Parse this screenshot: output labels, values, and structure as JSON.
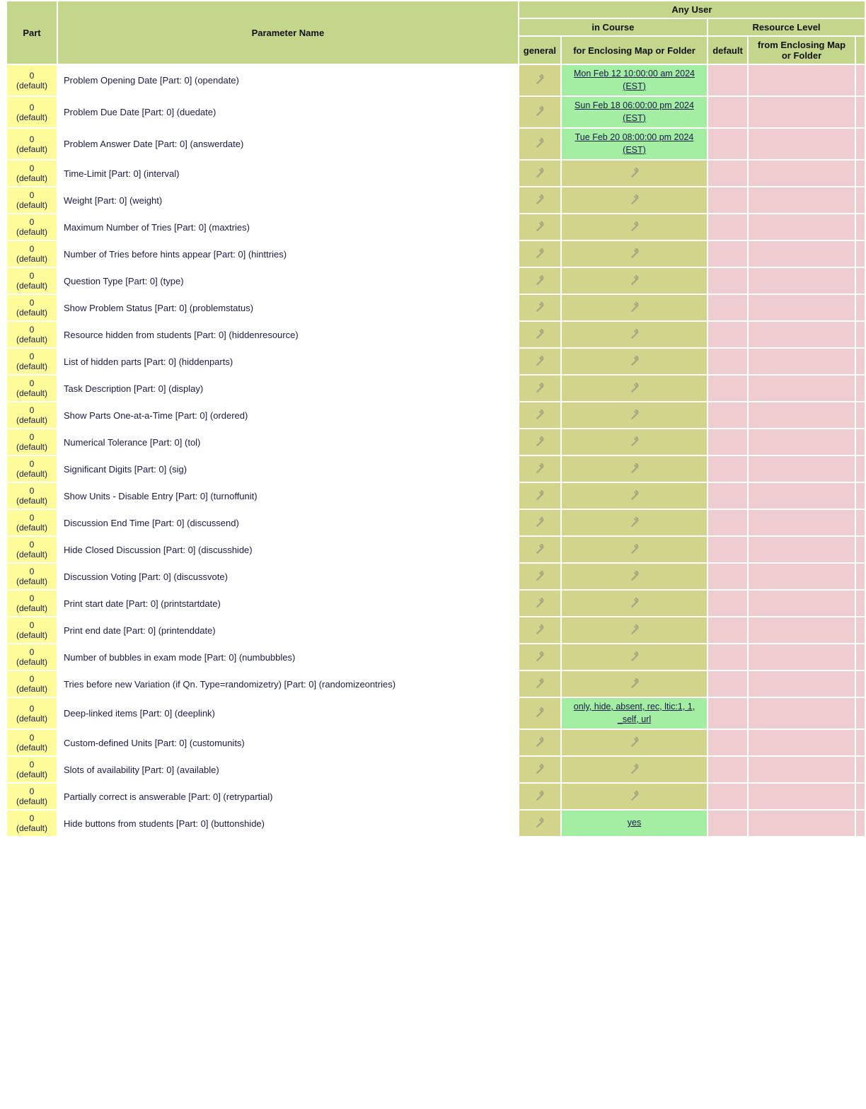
{
  "headers": {
    "any_user": "Any User",
    "in_course": "in Course",
    "resource_level": "Resource Level",
    "part": "Part",
    "parameter_name": "Parameter Name",
    "general": "general",
    "for_enclosing": "for Enclosing Map or Folder",
    "default": "default",
    "from_enclosing": "from Enclosing Map or Folder"
  },
  "rows": [
    {
      "part": "0 (default)",
      "name": "Problem Opening Date [Part: 0] (opendate)",
      "enclosing_val": "Mon Feb 12 10:00:00 am 2024 (EST)",
      "green": true
    },
    {
      "part": "0 (default)",
      "name": "Problem Due Date [Part: 0] (duedate)",
      "enclosing_val": "Sun Feb 18 06:00:00 pm 2024 (EST)",
      "green": true
    },
    {
      "part": "0 (default)",
      "name": "Problem Answer Date [Part: 0] (answerdate)",
      "enclosing_val": "Tue Feb 20 08:00:00 pm 2024 (EST)",
      "green": true
    },
    {
      "part": "0 (default)",
      "name": "Time-Limit [Part: 0] (interval)",
      "enclosing_val": "",
      "green": false,
      "wrench": true
    },
    {
      "part": "0 (default)",
      "name": "Weight [Part: 0] (weight)",
      "enclosing_val": "",
      "green": false,
      "wrench": true
    },
    {
      "part": "0 (default)",
      "name": "Maximum Number of Tries [Part: 0] (maxtries)",
      "enclosing_val": "",
      "green": false,
      "wrench": true
    },
    {
      "part": "0 (default)",
      "name": "Number of Tries before hints appear [Part: 0] (hinttries)",
      "enclosing_val": "",
      "green": false,
      "wrench": true
    },
    {
      "part": "0 (default)",
      "name": "Question Type [Part: 0] (type)",
      "enclosing_val": "",
      "green": false,
      "wrench": true
    },
    {
      "part": "0 (default)",
      "name": "Show Problem Status [Part: 0] (problemstatus)",
      "enclosing_val": "",
      "green": false,
      "wrench": true
    },
    {
      "part": "0 (default)",
      "name": "Resource hidden from students [Part: 0] (hiddenresource)",
      "enclosing_val": "",
      "green": false,
      "wrench": true
    },
    {
      "part": "0 (default)",
      "name": "List of hidden parts [Part: 0] (hiddenparts)",
      "enclosing_val": "",
      "green": false,
      "wrench": true
    },
    {
      "part": "0 (default)",
      "name": "Task Description [Part: 0] (display)",
      "enclosing_val": "",
      "green": false,
      "wrench": true
    },
    {
      "part": "0 (default)",
      "name": "Show Parts One-at-a-Time [Part: 0] (ordered)",
      "enclosing_val": "",
      "green": false,
      "wrench": true
    },
    {
      "part": "0 (default)",
      "name": "Numerical Tolerance [Part: 0] (tol)",
      "enclosing_val": "",
      "green": false,
      "wrench": true
    },
    {
      "part": "0 (default)",
      "name": "Significant Digits [Part: 0] (sig)",
      "enclosing_val": "",
      "green": false,
      "wrench": true
    },
    {
      "part": "0 (default)",
      "name": "Show Units - Disable Entry [Part: 0] (turnoffunit)",
      "enclosing_val": "",
      "green": false,
      "wrench": true
    },
    {
      "part": "0 (default)",
      "name": "Discussion End Time [Part: 0] (discussend)",
      "enclosing_val": "",
      "green": false,
      "wrench": true
    },
    {
      "part": "0 (default)",
      "name": "Hide Closed Discussion [Part: 0] (discusshide)",
      "enclosing_val": "",
      "green": false,
      "wrench": true
    },
    {
      "part": "0 (default)",
      "name": "Discussion Voting [Part: 0] (discussvote)",
      "enclosing_val": "",
      "green": false,
      "wrench": true
    },
    {
      "part": "0 (default)",
      "name": "Print start date [Part: 0] (printstartdate)",
      "enclosing_val": "",
      "green": false,
      "wrench": true
    },
    {
      "part": "0 (default)",
      "name": "Print end date [Part: 0] (printenddate)",
      "enclosing_val": "",
      "green": false,
      "wrench": true
    },
    {
      "part": "0 (default)",
      "name": "Number of bubbles in exam mode [Part: 0] (numbubbles)",
      "enclosing_val": "",
      "green": false,
      "wrench": true
    },
    {
      "part": "0 (default)",
      "name": "Tries before new Variation (if Qn. Type=randomizetry) [Part: 0] (randomizeontries)",
      "enclosing_val": "",
      "green": false,
      "wrench": true
    },
    {
      "part": "0 (default)",
      "name": "Deep-linked items [Part: 0] (deeplink)",
      "enclosing_val": "only, hide, absent, rec, ltic:1, 1, _self, url",
      "green": true
    },
    {
      "part": "0 (default)",
      "name": "Custom-defined Units [Part: 0] (customunits)",
      "enclosing_val": "",
      "green": false,
      "wrench": true
    },
    {
      "part": "0 (default)",
      "name": "Slots of availability [Part: 0] (available)",
      "enclosing_val": "",
      "green": false,
      "wrench": true
    },
    {
      "part": "0 (default)",
      "name": "Partially correct is answerable [Part: 0] (retrypartial)",
      "enclosing_val": "",
      "green": false,
      "wrench": true
    },
    {
      "part": "0 (default)",
      "name": "Hide buttons from students [Part: 0] (buttonshide)",
      "enclosing_val": "yes",
      "green": true
    }
  ]
}
